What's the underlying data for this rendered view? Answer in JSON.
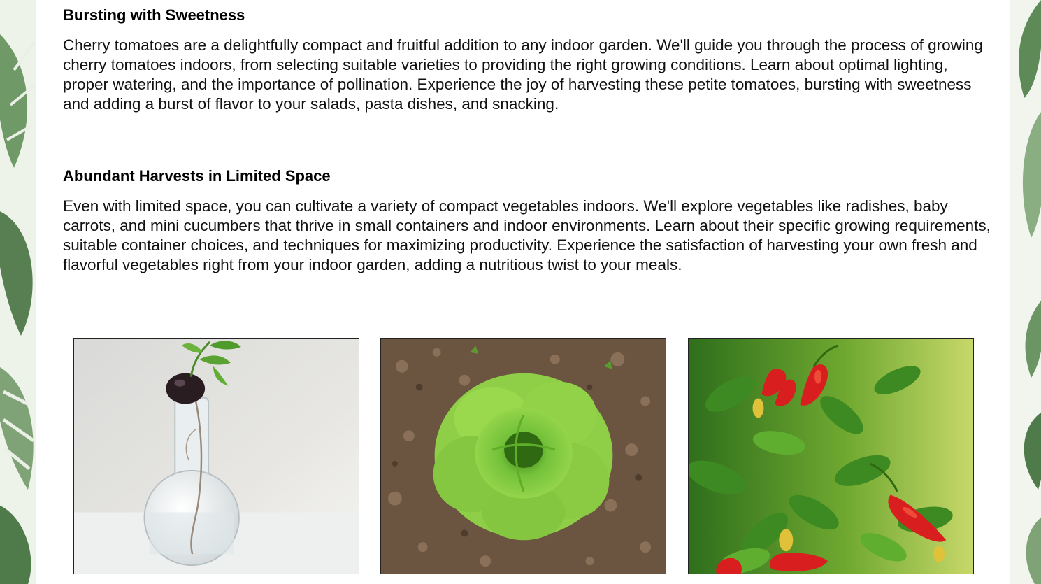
{
  "sections": [
    {
      "heading": "Bursting with Sweetness",
      "body": "Cherry tomatoes are a delightfully compact and fruitful addition to any indoor garden. We'll guide you through the process of growing cherry tomatoes indoors, from selecting suitable varieties to providing the right growing conditions. Learn about optimal lighting, proper watering, and the importance of pollination. Experience the joy of harvesting these petite tomatoes, bursting with sweetness and adding a burst of flavor to your salads, pasta dishes, and snacking."
    },
    {
      "heading": "Abundant Harvests in Limited Space",
      "body": "Even with limited space, you can cultivate a variety of compact vegetables indoors. We'll explore vegetables like radishes, baby carrots, and mini cucumbers that thrive in small containers and indoor environments. Learn about their specific growing requirements, suitable container choices, and techniques for maximizing productivity. Experience the satisfaction of harvesting your own fresh and flavorful vegetables right from your indoor garden, adding a nutritious twist to your meals."
    }
  ],
  "colors": {
    "leaf_dark": "#3f6b3c",
    "leaf_light": "#7fa377",
    "border": "#8fbf84"
  }
}
